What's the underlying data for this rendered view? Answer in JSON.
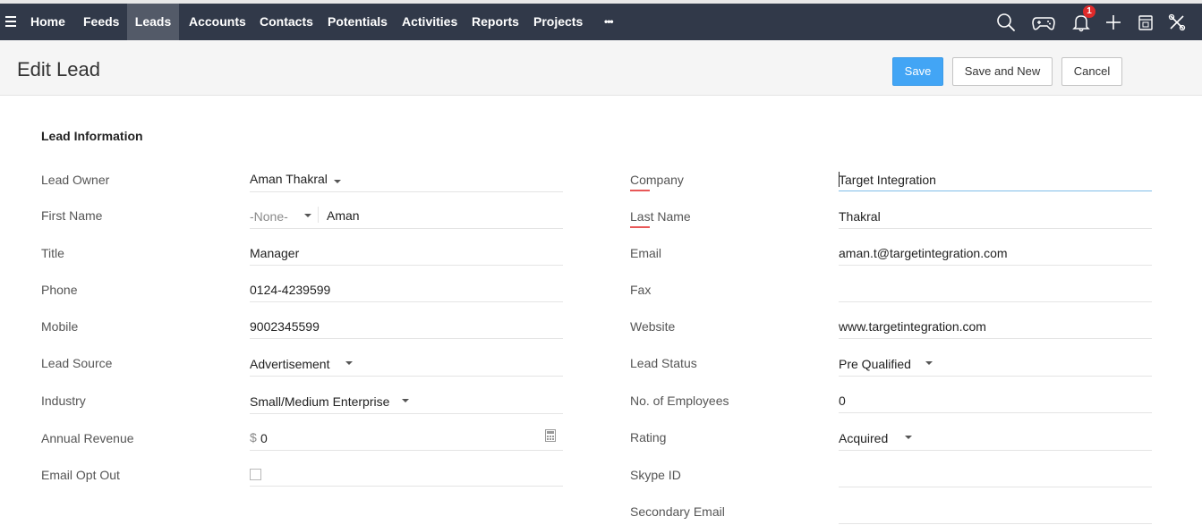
{
  "nav": {
    "items": [
      {
        "label": "Home"
      },
      {
        "label": "Feeds"
      },
      {
        "label": "Leads"
      },
      {
        "label": "Accounts"
      },
      {
        "label": "Contacts"
      },
      {
        "label": "Potentials"
      },
      {
        "label": "Activities"
      },
      {
        "label": "Reports"
      },
      {
        "label": "Projects"
      },
      {
        "label": "•••"
      }
    ],
    "active": "Leads",
    "notification_count": "1",
    "colors": {
      "bar": "#313949",
      "active": "#535a68",
      "badge": "#e02a2a"
    }
  },
  "header": {
    "title": "Edit Lead",
    "save_label": "Save",
    "save_new_label": "Save and New",
    "cancel_label": "Cancel",
    "save_color": "#42a5f5"
  },
  "section": {
    "title": "Lead Information"
  },
  "left": [
    {
      "label": "Lead Owner",
      "value": "Aman Thakral"
    },
    {
      "label": "First Name",
      "salutation": "-None-",
      "value": "Aman"
    },
    {
      "label": "Title",
      "value": "Manager"
    },
    {
      "label": "Phone",
      "value": "0124-4239599"
    },
    {
      "label": "Mobile",
      "value": "9002345599"
    },
    {
      "label": "Lead Source",
      "value": "Advertisement"
    },
    {
      "label": "Industry",
      "value": "Small/Medium Enterprise"
    },
    {
      "label": "Annual Revenue",
      "currency": "$",
      "value": "0"
    },
    {
      "label": "Email Opt Out",
      "value": ""
    }
  ],
  "right": [
    {
      "label": "Company",
      "value": "Target Integration"
    },
    {
      "label": "Last Name",
      "value": "Thakral"
    },
    {
      "label": "Email",
      "value": "aman.t@targetintegration.com"
    },
    {
      "label": "Fax",
      "value": ""
    },
    {
      "label": "Website",
      "value": "www.targetintegration.com"
    },
    {
      "label": "Lead Status",
      "value": "Pre Qualified"
    },
    {
      "label": "No. of Employees",
      "value": "0"
    },
    {
      "label": "Rating",
      "value": "Acquired"
    },
    {
      "label": "Skype ID",
      "value": ""
    },
    {
      "label": "Secondary Email",
      "value": ""
    }
  ]
}
